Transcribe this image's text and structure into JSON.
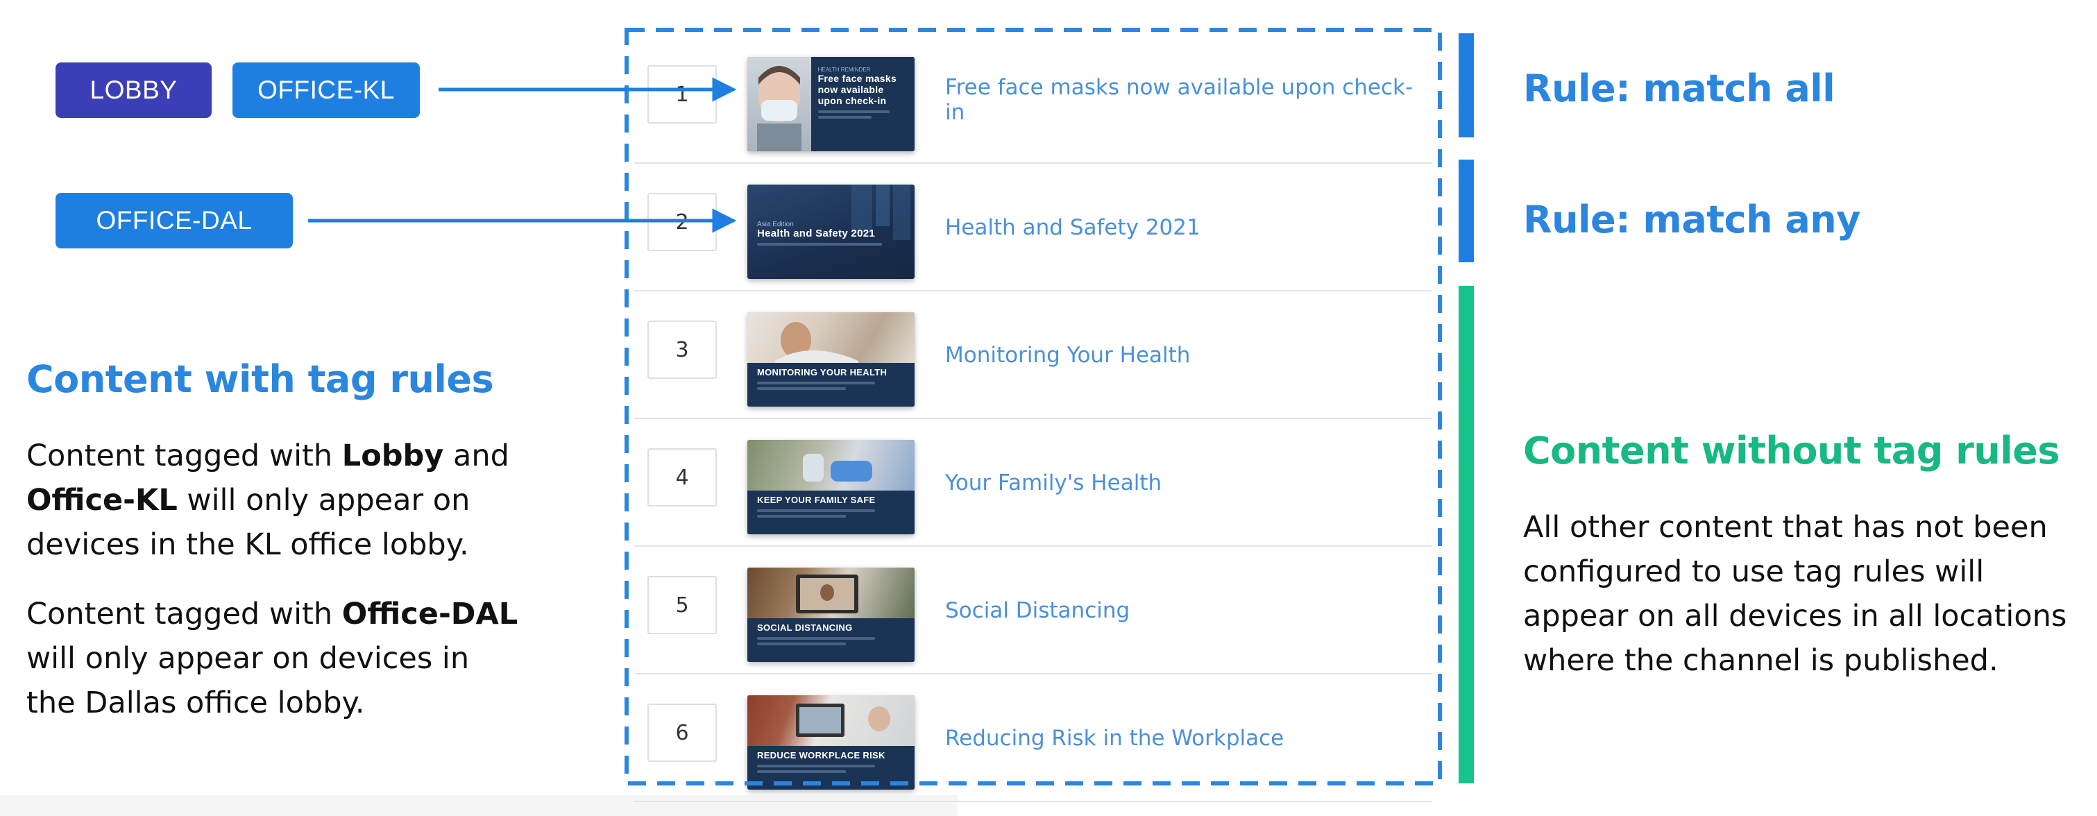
{
  "tags": {
    "lobby": "LOBBY",
    "office_kl": "OFFICE-KL",
    "office_dal": "OFFICE-DAL"
  },
  "left": {
    "heading": "Content with tag rules",
    "p1": {
      "t1": "Content tagged with ",
      "b1": "Lobby",
      "t2": " and ",
      "b2": "Office-KL",
      "t3": " will only appear on devices in the KL office lobby."
    },
    "p2": {
      "t1": "Content tagged with ",
      "b1": "Office-DAL",
      "t2": " will only appear on devices in the Dallas office lobby."
    }
  },
  "right": {
    "rule_all": "Rule: match all",
    "rule_any": "Rule: match any",
    "heading": "Content without tag rules",
    "para": "All other content that has not been configured to use tag rules will appear on all devices in all locations where the channel is published."
  },
  "playlist": [
    {
      "num": "1",
      "title": "Free face masks now available upon check-in",
      "thumb_title": "Free face masks now available upon check-in",
      "thumb_kicker": "HEALTH REMINDER"
    },
    {
      "num": "2",
      "title": "Health and Safety 2021",
      "thumb_title": "Health and Safety 2021",
      "thumb_kicker": "Asia Edition"
    },
    {
      "num": "3",
      "title": "Monitoring Your Health",
      "thumb_title": "MONITORING YOUR HEALTH"
    },
    {
      "num": "4",
      "title": "Your Family's Health",
      "thumb_title": "KEEP YOUR FAMILY SAFE"
    },
    {
      "num": "5",
      "title": "Social Distancing",
      "thumb_title": "SOCIAL DISTANCING"
    },
    {
      "num": "6",
      "title": "Reducing Risk in the Workplace",
      "thumb_title": "REDUCE WORKPLACE RISK"
    }
  ],
  "colors": {
    "blue": "#1f7fe0",
    "indigo": "#3b3fb5",
    "green": "#18c28c",
    "heading_blue": "#2a86df",
    "link_blue": "#4a90d9"
  }
}
